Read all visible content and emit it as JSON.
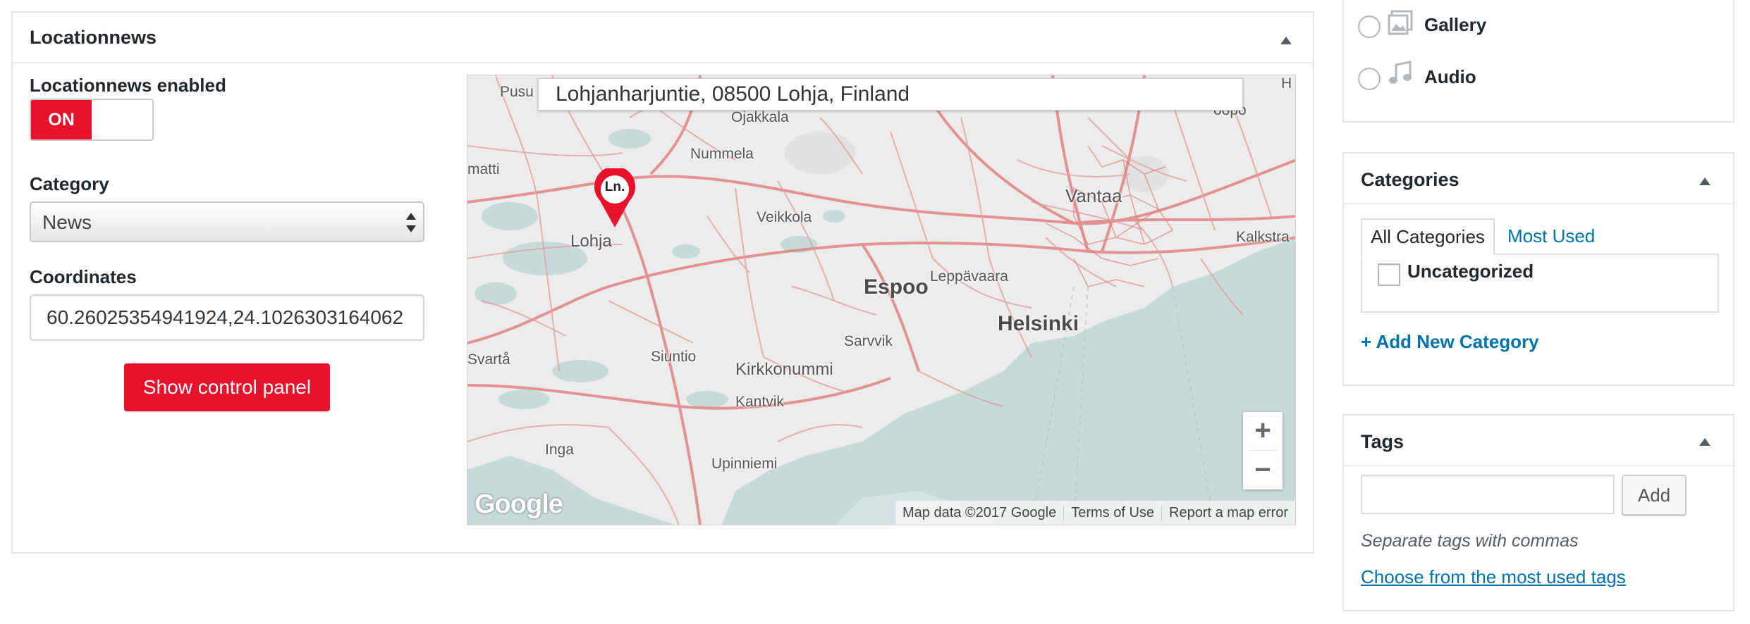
{
  "locationnews": {
    "title": "Locationnews",
    "enabled_label": "Locationnews enabled",
    "switch_on": "ON",
    "category_label": "Category",
    "category_value": "News",
    "coordinates_label": "Coordinates",
    "coordinates_value": "60.26025354941924,24.1026303164062",
    "show_panel_button": "Show control panel",
    "brand_color": "#e8122d"
  },
  "map": {
    "search_value": "Lohjanharjuntie, 08500 Lohja, Finland",
    "marker_text": "Ln.",
    "zoom_in": "+",
    "zoom_out": "−",
    "google_logo": "Google",
    "attribution": {
      "map_data": "Map data ©2017 Google",
      "terms": "Terms of Use",
      "report": "Report a map error"
    },
    "places": {
      "pusu": "Pusu",
      "ojakkala": "Ojakkala",
      "nummela": "Nummela",
      "matti": "matti",
      "lohja": "Lohja",
      "veikkola": "Veikkola",
      "vantaa": "Vantaa",
      "kalkstra": "Kalkstra",
      "espoo": "Espoo",
      "leppavaara": "Leppävaara",
      "helsinki": "Helsinki",
      "svarta": "Svartå",
      "siuntio": "Siuntio",
      "sarvvik": "Sarvvik",
      "kirkkonummi": "Kirkkonummi",
      "kantvik": "Kantvik",
      "inga": "Inga",
      "upinniemi": "Upinniemi",
      "h": "H",
      "topo": "oopo"
    },
    "colors": {
      "roads": "#e07c7c",
      "water": "#c6dada",
      "land": "#ececec"
    }
  },
  "format": {
    "gallery_label": "Gallery",
    "audio_label": "Audio",
    "gallery_icon": "gallery-icon",
    "audio_icon": "audio-icon"
  },
  "categories": {
    "title": "Categories",
    "tab_all": "All Categories",
    "tab_most_used": "Most Used",
    "items": [
      {
        "label": "Uncategorized",
        "checked": false
      }
    ],
    "add_new": "+ Add New Category"
  },
  "tags": {
    "title": "Tags",
    "input_value": "",
    "add_button": "Add",
    "hint": "Separate tags with commas",
    "choose_link": "Choose from the most used tags"
  }
}
